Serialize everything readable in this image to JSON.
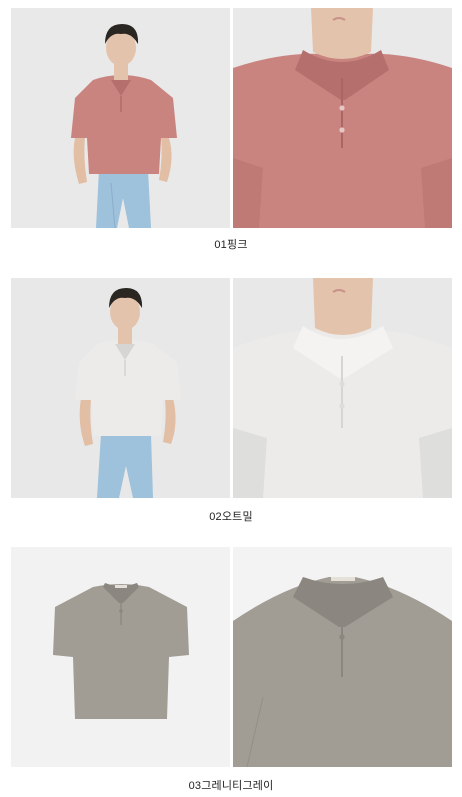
{
  "colors": {
    "pink": "#c98480",
    "pink_shadow": "#b56f6c",
    "oatmeal": "#ecebea",
    "oatmeal_shadow": "#d6d5d3",
    "greige": "#a19c94",
    "greige_shadow": "#8b867f",
    "studio_bg": "#e8e8e8",
    "studio_bg_light": "#f3f3f3",
    "denim": "#9ec1dc",
    "skin": "#e3c3ab",
    "hair": "#2a2622"
  },
  "products": [
    {
      "caption": "01핑크",
      "left_photo": "model-full-body",
      "right_photo": "collar-closeup"
    },
    {
      "caption": "02오트밀",
      "left_photo": "model-full-body",
      "right_photo": "collar-closeup"
    },
    {
      "caption": "03그레니티그레이",
      "left_photo": "flat-garment",
      "right_photo": "garment-closeup"
    }
  ]
}
